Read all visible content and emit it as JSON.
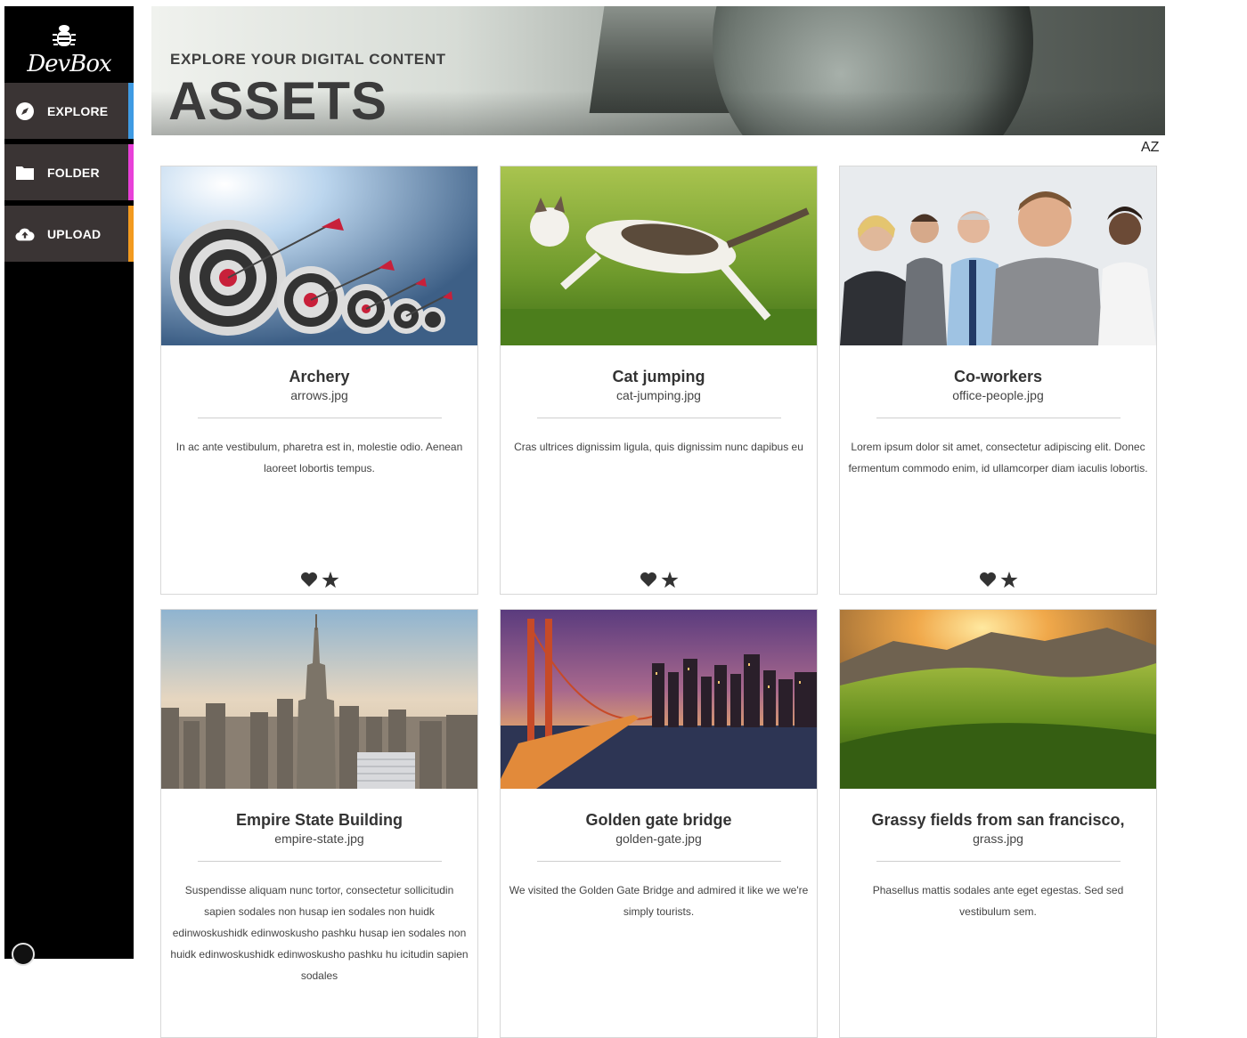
{
  "brand": {
    "logo_text": "DevBox",
    "logo_icon": "bug-icon"
  },
  "nav": [
    {
      "label": "EXPLORE",
      "icon": "compass-icon",
      "accent": "#3f9be3"
    },
    {
      "label": "FOLDER",
      "icon": "folder-icon",
      "accent": "#e840d8"
    },
    {
      "label": "UPLOAD",
      "icon": "cloud-upload-icon",
      "accent": "#f29a1f"
    }
  ],
  "header": {
    "kicker": "EXPLORE YOUR DIGITAL CONTENT",
    "title": "ASSETS"
  },
  "sort": {
    "label": "AZ",
    "icon": "sort-alpha-icon"
  },
  "cards": [
    {
      "title": "Archery",
      "file": "arrows.jpg",
      "description": "In ac ante vestibulum, pharetra est in, molestie odio. Aenean laoreet lobortis tempus."
    },
    {
      "title": "Cat jumping",
      "file": "cat-jumping.jpg",
      "description": "Cras ultrices dignissim ligula, quis dignissim nunc dapibus eu"
    },
    {
      "title": "Co-workers",
      "file": "office-people.jpg",
      "description": "Lorem ipsum dolor sit amet, consectetur adipiscing elit. Donec fermentum commodo enim, id ullamcorper diam iaculis lobortis."
    },
    {
      "title": "Empire State Building",
      "file": "empire-state.jpg",
      "description": "Suspendisse aliquam nunc tortor, consectetur sollicitudin sapien sodales non husap ien sodales non huidk edinwoskushidk edinwoskusho pashku husap ien sodales non huidk edinwoskushidk edinwoskusho pashku hu icitudin sapien sodales"
    },
    {
      "title": "Golden gate bridge",
      "file": "golden-gate.jpg",
      "description": "We visited the Golden Gate Bridge and admired it like we we're simply tourists."
    },
    {
      "title": "Grassy fields from san francisco,",
      "file": "grass.jpg",
      "description": "Phasellus mattis sodales ante eget egestas. Sed sed vestibulum sem."
    }
  ],
  "card_actions": {
    "like_icon": "heart-icon",
    "favorite_icon": "star-icon"
  }
}
